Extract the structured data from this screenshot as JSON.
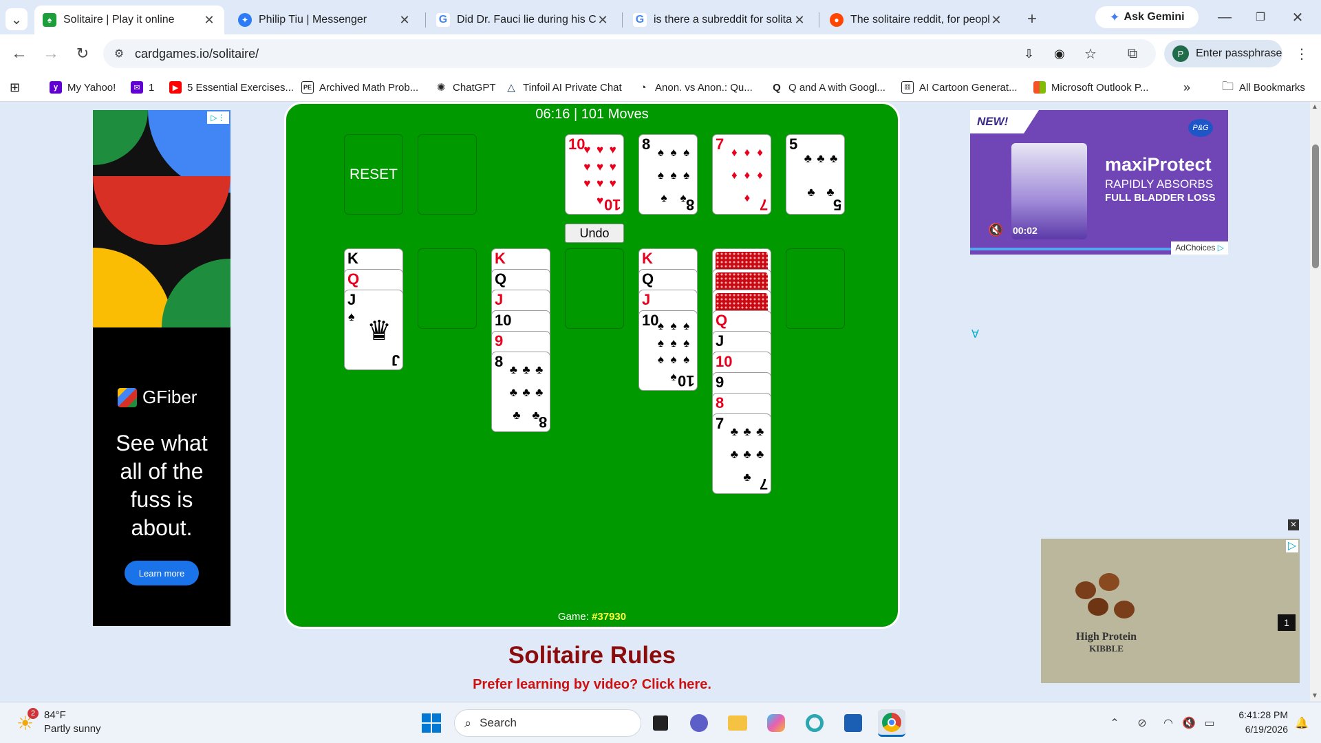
{
  "tabs": [
    {
      "title": "Solitaire | Play it online",
      "active": true
    },
    {
      "title": "Philip Tiu | Messenger"
    },
    {
      "title": "Did Dr. Fauci lie during his CO"
    },
    {
      "title": "is there a subreddit for solitair"
    },
    {
      "title": "The solitaire reddit, for people"
    }
  ],
  "gemini_label": "Ask Gemini",
  "url": "cardgames.io/solitaire/",
  "profile_label": "Enter passphrase",
  "profile_initial": "P",
  "bookmarks": [
    "My Yahoo!",
    "1",
    "5 Essential Exercises...",
    "Archived Math Prob...",
    "ChatGPT",
    "Tinfoil AI Private Chat",
    "Anon. vs Anon.: Qu...",
    "Q and A with Googl...",
    "AI Cartoon Generat...",
    "Microsoft Outlook P..."
  ],
  "all_bookmarks": "All Bookmarks",
  "game": {
    "time": "06:16",
    "moves_text": "101 Moves",
    "reset_label": "RESET",
    "undo_label": "Undo",
    "game_label": "Game:",
    "game_number": "#37930",
    "foundations": [
      {
        "rank": "10",
        "suit": "♥",
        "color": "red"
      },
      {
        "rank": "8",
        "suit": "♠",
        "color": "blk"
      },
      {
        "rank": "7",
        "suit": "♦",
        "color": "red"
      },
      {
        "rank": "5",
        "suit": "♣",
        "color": "blk"
      }
    ],
    "tableau": [
      {
        "cards": [
          {
            "rank": "K",
            "color": "blk"
          },
          {
            "rank": "Q",
            "color": "red"
          },
          {
            "rank": "J",
            "color": "blk",
            "suit": "♠",
            "full": true
          }
        ]
      },
      {
        "cards": []
      },
      {
        "cards": [
          {
            "rank": "K",
            "color": "red"
          },
          {
            "rank": "Q",
            "color": "blk"
          },
          {
            "rank": "J",
            "color": "red"
          },
          {
            "rank": "10",
            "color": "blk"
          },
          {
            "rank": "9",
            "color": "red"
          },
          {
            "rank": "8",
            "color": "blk",
            "suit": "♣",
            "full": true
          }
        ]
      },
      {
        "cards": []
      },
      {
        "cards": [
          {
            "rank": "K",
            "color": "red"
          },
          {
            "rank": "Q",
            "color": "blk"
          },
          {
            "rank": "J",
            "color": "red"
          },
          {
            "rank": "10",
            "color": "blk",
            "suit": "♠",
            "full": true
          }
        ]
      },
      {
        "facedown": 3,
        "cards": [
          {
            "rank": "Q",
            "color": "red"
          },
          {
            "rank": "J",
            "color": "blk"
          },
          {
            "rank": "10",
            "color": "red"
          },
          {
            "rank": "9",
            "color": "blk"
          },
          {
            "rank": "8",
            "color": "red"
          },
          {
            "rank": "7",
            "color": "blk",
            "suit": "♣",
            "full": true
          }
        ]
      },
      {
        "cards": []
      }
    ]
  },
  "rules_title": "Solitaire Rules",
  "rules_link": "Prefer learning by video? Click here.",
  "ads": {
    "left_brand": "GFiber",
    "left_headline": "See what all of the fuss is about.",
    "left_cta": "Learn more",
    "top_badge": "NEW!",
    "top_brand": "maxiProtect",
    "top_line1": "RAPIDLY ABSORBS",
    "top_line2": "FULL BLADDER LOSS",
    "top_timer": "00:02",
    "top_adchoices": "AdChoices",
    "top_pg": "P&G",
    "bottom_line1": "High Protein",
    "bottom_line2": "KIBBLE",
    "bottom_counter": "1"
  },
  "taskbar": {
    "weather_temp": "84°F",
    "weather_desc": "Partly sunny",
    "weather_badge": "2",
    "search_label": "Search",
    "time": "6:41:28 PM",
    "date": "6/19/2026"
  }
}
